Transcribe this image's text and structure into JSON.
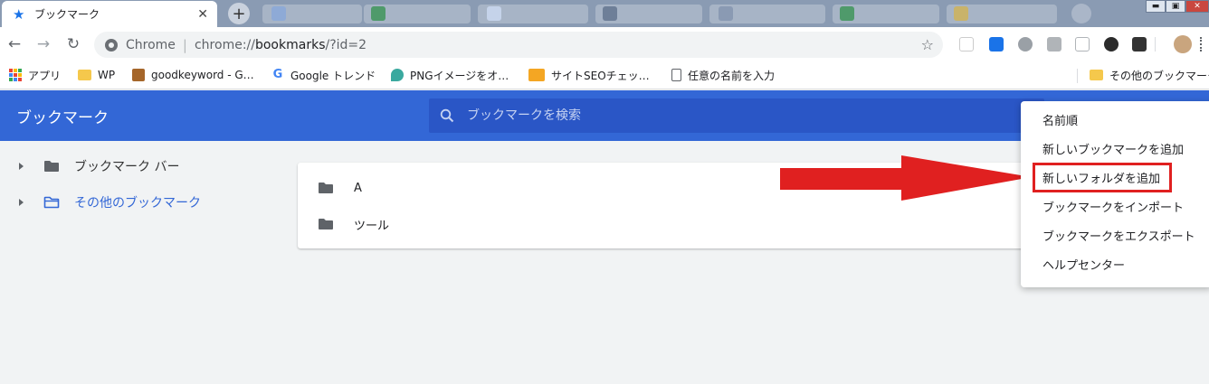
{
  "tab": {
    "title": "ブックマーク",
    "close": "✕",
    "new_tab": "+"
  },
  "toolbar": {
    "back": "←",
    "forward": "→",
    "reload": "↻",
    "omnibox_label": "Chrome",
    "omnibox_sep": "|",
    "url_prefix": "chrome://",
    "url_host": "bookmarks",
    "url_path": "/?id=2",
    "star": "☆"
  },
  "bookmarks_bar": {
    "items": [
      {
        "label": "アプリ"
      },
      {
        "label": "WP"
      },
      {
        "label": "goodkeyword - G…"
      },
      {
        "label": "Google トレンド"
      },
      {
        "label": "PNGイメージをオ…"
      },
      {
        "label": "サイトSEOチェッ…"
      },
      {
        "label": "任意の名前を入力"
      }
    ],
    "other": "その他のブックマーク"
  },
  "app": {
    "title": "ブックマーク",
    "search_placeholder": "ブックマークを検索"
  },
  "sidebar": {
    "items": [
      {
        "label": "ブックマーク バー"
      },
      {
        "label": "その他のブックマーク"
      }
    ]
  },
  "list": {
    "items": [
      {
        "label": "A"
      },
      {
        "label": "ツール"
      }
    ]
  },
  "menu": {
    "items": [
      {
        "label": "名前順"
      },
      {
        "label": "新しいブックマークを追加"
      },
      {
        "label": "新しいフォルダを追加"
      },
      {
        "label": "ブックマークをインポート"
      },
      {
        "label": "ブックマークをエクスポート"
      },
      {
        "label": "ヘルプセンター"
      }
    ]
  },
  "colors": {
    "accent": "#3367d6",
    "search_bg": "#2a56c6",
    "annotation_red": "#e02020"
  }
}
